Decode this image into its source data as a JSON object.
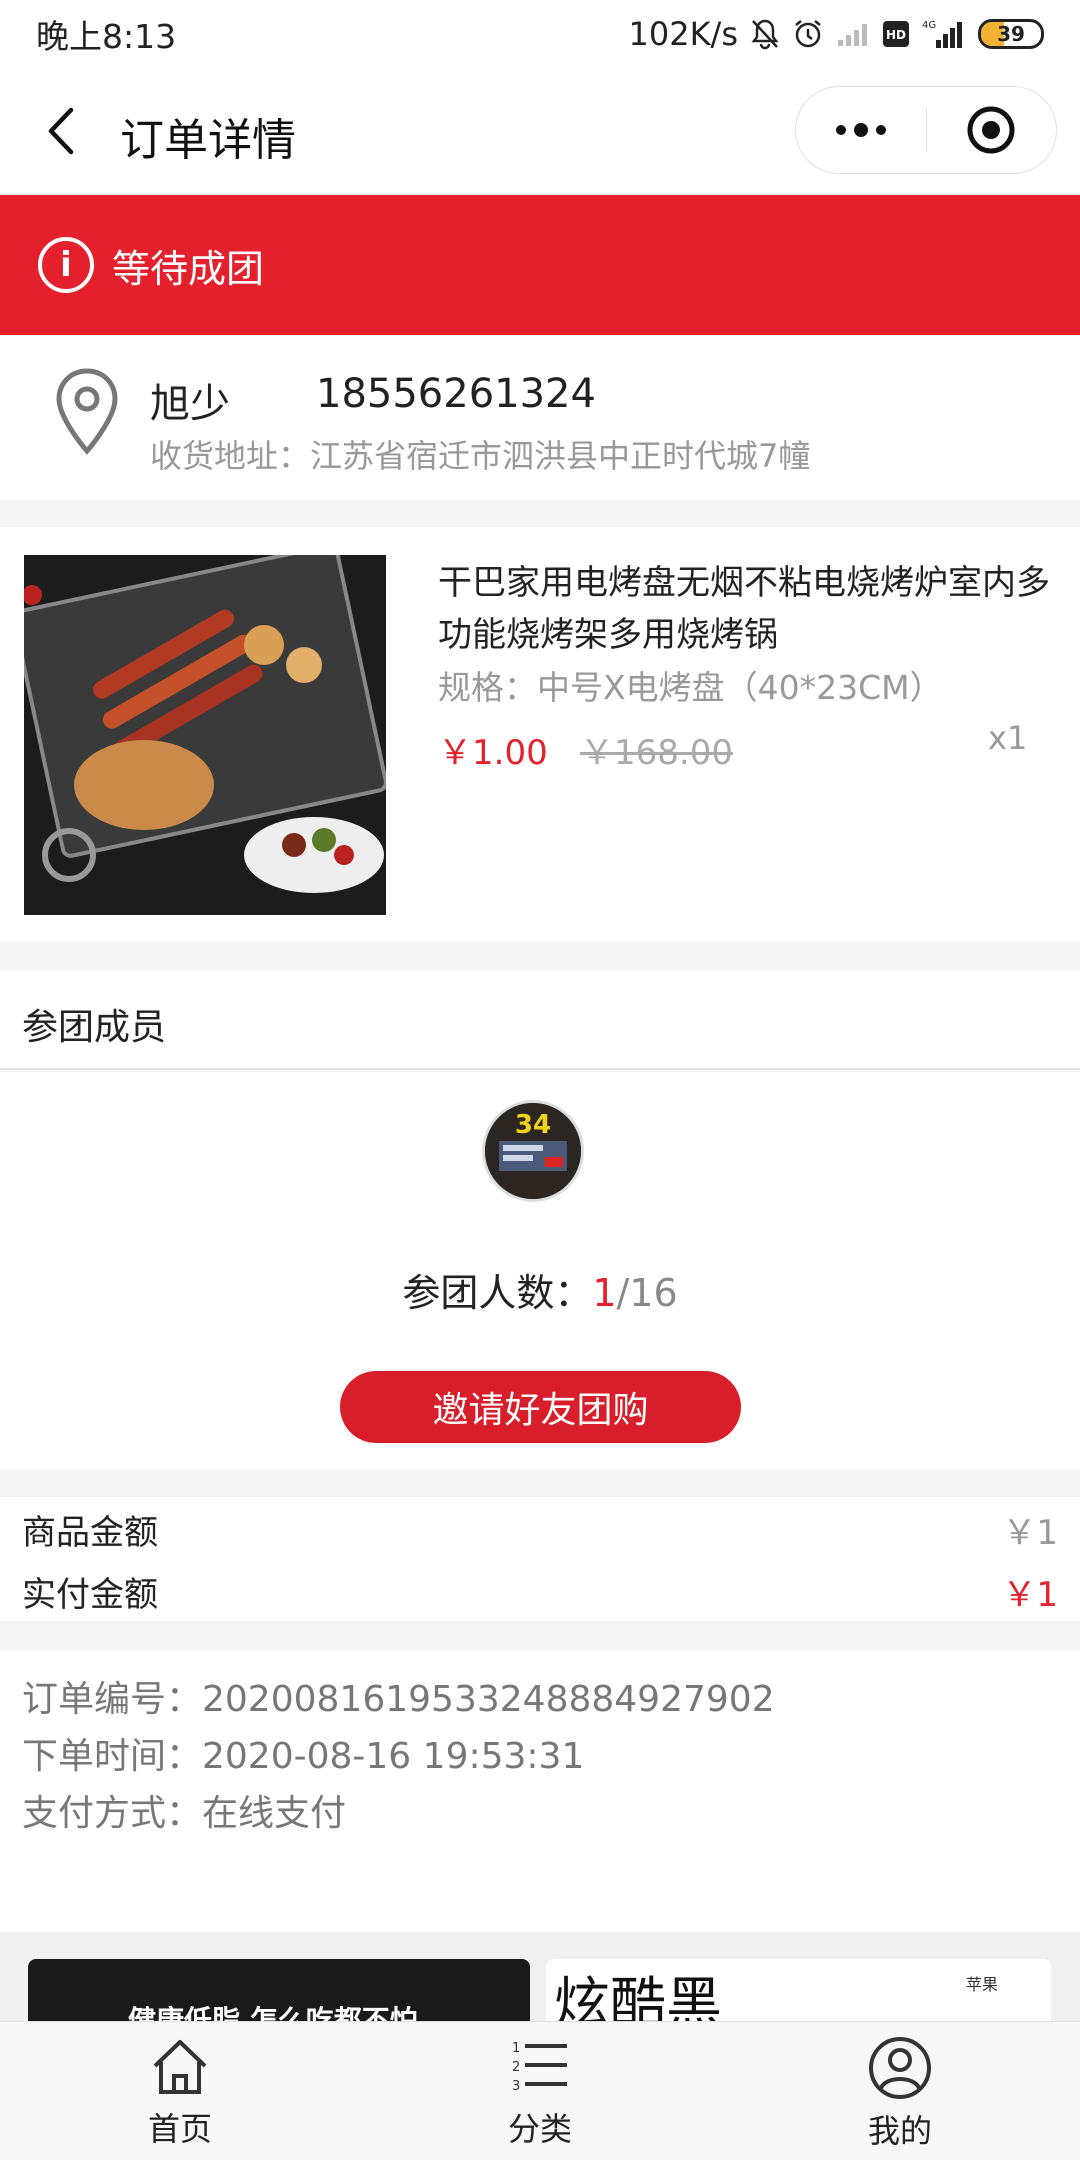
{
  "status_bar": {
    "time": "晚上8:13",
    "speed": "102K/s",
    "network": "4G",
    "hd": "HD",
    "battery": "39",
    "battery_level": 0.39
  },
  "nav": {
    "title": "订单详情"
  },
  "banner": {
    "text": "等待成团",
    "color": "#e4202c"
  },
  "address": {
    "name": "旭少",
    "phone": "18556261324",
    "line": "收货地址：江苏省宿迁市泗洪县中正时代城7幢"
  },
  "product": {
    "title": "干巴家用电烤盘无烟不粘电烧烤炉室内多功能烧烤架多用烧烤锅",
    "spec": "规格：中号X电烤盘（40*23CM）",
    "price": "￥1.00",
    "original_price": "￥168.00",
    "quantity": "x1"
  },
  "members": {
    "heading": "参团成员",
    "avatar_number": "34",
    "count_label": "参团人数：",
    "count_current": "1",
    "count_total": "/16",
    "invite_button": "邀请好友团购"
  },
  "amounts": {
    "goods_label": "商品金额",
    "goods_value": "￥1",
    "paid_label": "实付金额",
    "paid_value": "￥1"
  },
  "order_info": {
    "number": "订单编号：2020081619533248884927902",
    "time": "下单时间：2020-08-16 19:53:31",
    "payment": "支付方式：在线支付"
  },
  "ads": {
    "left_text": "健康低脂 怎么吃都不怕",
    "right_title": "炫酷黑",
    "right_small": "苹果"
  },
  "tabbar": {
    "items": [
      {
        "label": "首页",
        "icon": "home-icon"
      },
      {
        "label": "分类",
        "icon": "category-list-icon"
      },
      {
        "label": "我的",
        "icon": "user-icon"
      }
    ]
  },
  "colors": {
    "accent": "#e4202c",
    "muted": "#999999"
  }
}
